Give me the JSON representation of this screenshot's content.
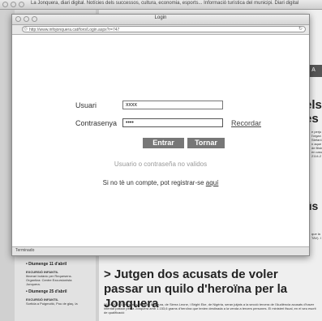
{
  "background_window": {
    "title": "La Jonquera, diari digital. Notícies dels successos, cultura, economia, esports... Informació turística del municipi. Diari digital",
    "right_bar_text": "o A",
    "right_word_1": "els",
    "right_word_2": "es",
    "right_word_3": "ús",
    "right_snippet_1": "e perju\nl'organ\nStefani\nn aque\nde Bisb\nen casc\n2114-2",
    "right_snippet_2": "que la\nTAV). I",
    "sidebar_events": [
      {
        "date": "• Diumenge 11 d'abril",
        "lines": [
          "EXCURSIÓ INFANTIL",
          "Itinerari botànic per Requesens.",
          "Organitza: Centre Excursionista",
          "Jonquera."
        ]
      },
      {
        "date": "• Diumenge 25 d'abril",
        "lines": [
          "EXCURSIÓ INFANTIL",
          "Sortida a Puigmoltó, Pou de glaç, la"
        ]
      }
    ],
    "headline": "> Jutgen dos acusats de voler passar un quilo d'heroïna per la Jonquera",
    "article_text": "06/04/2010 Dos homes, Ibrahim Bangura, de Sierra Leone, i Bright Eke, de Nigèria, seran jutjats a la secció tercera de l'Audiència acusats d'haver intentat passar per la Jonquera amb 1.153,6 grams d'heroïna que tenien destinada a la venda a tercers persones. El ministeri fiscal, en el seu escrit de qualificació"
  },
  "login_window": {
    "title": "Login",
    "url": "http://www.infojonquera.cat/foro/Login.aspx?r=747",
    "status": "Terminado",
    "usuari_label": "Usuari",
    "usuari_value": "xxxx",
    "password_label": "Contrasenya",
    "password_value": "••••",
    "recordar_link": "Recordar",
    "entrar_button": "Entrar",
    "tornar_button": "Tornar",
    "error_message": "Usuario o contraseña no validos",
    "register_text": "Si no tè un compte, pot registrar-se",
    "register_link": "aquí"
  },
  "colors": {
    "button_bg": "#777777",
    "error_text": "#999999"
  }
}
